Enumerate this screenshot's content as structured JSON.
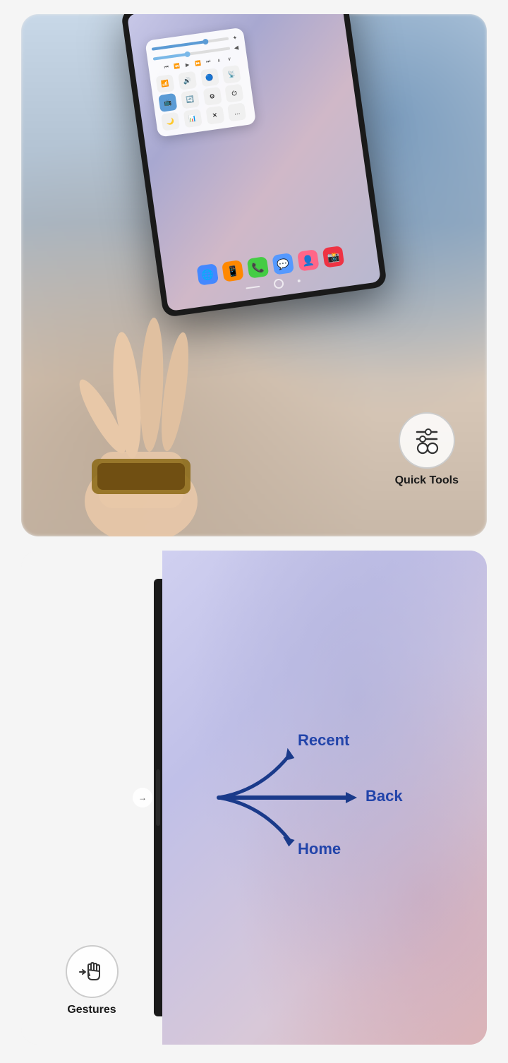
{
  "cards": [
    {
      "id": "quick-tools-card",
      "badge": {
        "label": "Quick Tools",
        "icon": "settings-sliders-icon"
      },
      "tablet": {
        "quick_panel": {
          "sliders": [
            {
              "fill": 70
            },
            {
              "fill": 45
            }
          ],
          "media_controls": [
            "⏮",
            "⏪",
            "▶",
            "⏩",
            "⏭",
            "∧",
            "∨"
          ],
          "grid_items": [
            {
              "icon": "wifi",
              "active": false
            },
            {
              "icon": "sound",
              "active": false
            },
            {
              "icon": "bt",
              "active": false
            },
            {
              "icon": "nfc",
              "active": false
            },
            {
              "icon": "screen",
              "active": true
            },
            {
              "icon": "rotation",
              "active": false
            },
            {
              "icon": "settings",
              "active": false
            },
            {
              "icon": "power",
              "active": false
            },
            {
              "icon": "moon",
              "active": false
            },
            {
              "icon": "data",
              "active": false
            },
            {
              "icon": "close",
              "active": false
            },
            {
              "icon": "more",
              "active": false
            }
          ]
        },
        "dock_apps": [
          "🌐",
          "📱",
          "📞",
          "💬",
          "👤",
          "📸"
        ]
      }
    },
    {
      "id": "gestures-card",
      "badge": {
        "label": "Gestures",
        "icon": "hand-swipe-icon"
      },
      "gesture_labels": {
        "recent": "Recent",
        "back": "Back",
        "home": "Home"
      }
    }
  ]
}
